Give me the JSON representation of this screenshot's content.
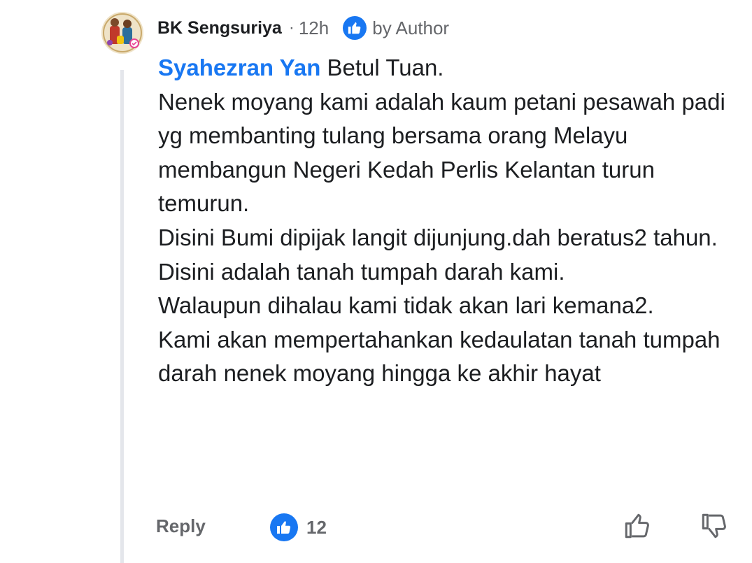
{
  "comment": {
    "author": "BK Sengsuriya",
    "separator": "·",
    "timestamp": "12h",
    "author_badge": {
      "icon": "thumbs-up-icon",
      "label": "by Author"
    },
    "mention": "Syahezran Yan",
    "first_line_rest": " Betul Tuan.",
    "lines": [
      "Nenek moyang kami adalah kaum petani pesawah padi yg membanting tulang bersama orang Melayu membangun Negeri Kedah Perlis Kelantan turun temurun.",
      "Disini Bumi dipijak langit dijunjung.dah beratus2 tahun.",
      "Disini adalah tanah tumpah darah kami.",
      "Walaupun dihalau kami tidak akan lari kemana2.",
      "Kami akan mempertahankan kedaulatan tanah tumpah darah nenek moyang hingga ke akhir hayat"
    ]
  },
  "footer": {
    "reply_label": "Reply",
    "reaction_icon": "like-reaction-icon",
    "reaction_count": "12",
    "actions": [
      "thumbs-up-outline-icon",
      "thumbs-down-outline-icon"
    ]
  },
  "colors": {
    "accent": "#1877f2",
    "secondary_text": "#65676b",
    "primary_text": "#1c1e21",
    "thread_line": "#e4e6eb"
  }
}
